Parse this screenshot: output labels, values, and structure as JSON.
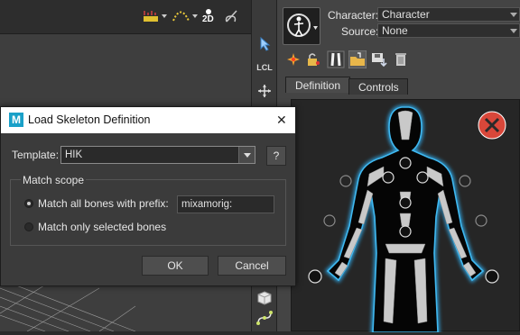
{
  "viewport": {
    "toolbar_icons": [
      "keyframe-ruler-icon",
      "motion-path-icon",
      "2d-view-icon",
      "pencil-draw-icon"
    ],
    "view_2d_label": "2D"
  },
  "vertical_toolbar": {
    "items": [
      {
        "icon": "select-arrow-icon"
      },
      {
        "label": "LCL"
      },
      {
        "icon": "move-cross-icon"
      },
      {
        "icon": "cube-icon"
      },
      {
        "icon": "curve-icon"
      }
    ]
  },
  "character_panel": {
    "character_label": "Character:",
    "character_value": "Character",
    "source_label": "Source:",
    "source_value": "None",
    "tabs": [
      {
        "label": "Definition",
        "active": true
      },
      {
        "label": "Controls",
        "active": false
      }
    ],
    "close_icon_color": "#d9473a",
    "body_glow_color": "#2fa8e8"
  },
  "dialog": {
    "title": "Load Skeleton Definition",
    "close_glyph": "✕",
    "template_label": "Template:",
    "template_value": "HIK",
    "help_label": "?",
    "match_scope_label": "Match scope",
    "option_prefix_label": "Match all bones with prefix:",
    "option_prefix_selected": true,
    "prefix_value": "mixamorig:",
    "option_selected_label": "Match only selected bones",
    "ok_label": "OK",
    "cancel_label": "Cancel"
  }
}
